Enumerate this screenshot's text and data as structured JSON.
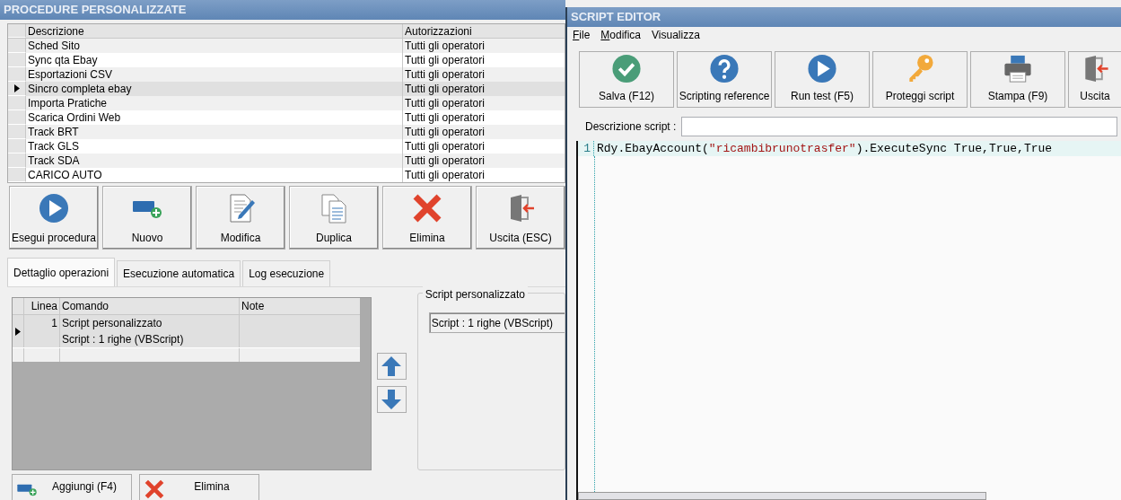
{
  "main_window": {
    "title": "PROCEDURE PERSONALIZZATE",
    "procedures_table": {
      "columns": [
        "Descrizione",
        "Autorizzazioni"
      ],
      "rows": [
        {
          "cells": [
            "Sched Sito",
            "Tutti gli operatori"
          ],
          "selected": false
        },
        {
          "cells": [
            "Sync qta Ebay",
            "Tutti gli operatori"
          ],
          "selected": false
        },
        {
          "cells": [
            "Esportazioni CSV",
            "Tutti gli operatori"
          ],
          "selected": false
        },
        {
          "cells": [
            "Sincro completa ebay",
            "Tutti gli operatori"
          ],
          "selected": true
        },
        {
          "cells": [
            "Importa Pratiche",
            "Tutti gli operatori"
          ],
          "selected": false
        },
        {
          "cells": [
            "Scarica Ordini Web",
            "Tutti gli operatori"
          ],
          "selected": false
        },
        {
          "cells": [
            "Track BRT",
            "Tutti gli operatori"
          ],
          "selected": false
        },
        {
          "cells": [
            "Track GLS",
            "Tutti gli operatori"
          ],
          "selected": false
        },
        {
          "cells": [
            "Track SDA",
            "Tutti gli operatori"
          ],
          "selected": false
        },
        {
          "cells": [
            "CARICO AUTO",
            "Tutti gli operatori"
          ],
          "selected": false
        }
      ]
    },
    "toolbar": [
      {
        "label": "Esegui procedura",
        "kind": "play"
      },
      {
        "label": "Nuovo",
        "kind": "add"
      },
      {
        "label": "Modifica",
        "kind": "edit"
      },
      {
        "label": "Duplica",
        "kind": "copy"
      },
      {
        "label": "Elimina",
        "kind": "delete"
      },
      {
        "label": "Uscita (ESC)",
        "kind": "exit"
      }
    ],
    "tabs": [
      {
        "label": "Dettaglio operazioni",
        "selected": true
      },
      {
        "label": "Esecuzione automatica",
        "selected": false
      },
      {
        "label": "Log esecuzione",
        "selected": false
      }
    ],
    "operations_table": {
      "columns": [
        "Linea",
        "Comando",
        "Note"
      ],
      "rows": [
        {
          "line": "1",
          "command": [
            "Script personalizzato",
            "Script : 1 righe (VBScript)"
          ],
          "selected": true
        }
      ]
    },
    "script_group": {
      "title": "Script personalizzato",
      "value": "Script : 1 righe (VBScript)"
    },
    "bottom_buttons": [
      {
        "label": "Aggiungi (F4)",
        "kind": "add"
      },
      {
        "label": "Elimina",
        "kind": "delete"
      }
    ]
  },
  "script_editor": {
    "title": "SCRIPT EDITOR",
    "menu": [
      {
        "label": "File",
        "mnemonic": true
      },
      {
        "label": "Modifica",
        "mnemonic": true
      },
      {
        "label": "Visualizza",
        "mnemonic": false
      }
    ],
    "toolbar": [
      {
        "label": "Salva (F12)",
        "kind": "save"
      },
      {
        "label": "Scripting reference",
        "kind": "help"
      },
      {
        "label": "Run test (F5)",
        "kind": "play"
      },
      {
        "label": "Proteggi script",
        "kind": "key"
      },
      {
        "label": "Stampa (F9)",
        "kind": "print"
      },
      {
        "label": "Uscita",
        "kind": "exit"
      }
    ],
    "description_label": "Descrizione script :",
    "code_lines": [
      {
        "number": "1",
        "parts": [
          {
            "text": "Rdy.EbayAccount(",
            "kind": "plain"
          },
          {
            "text": "\"ricambibrunotrasfer\"",
            "kind": "string"
          },
          {
            "text": ").ExecuteSync True,True,True",
            "kind": "plain"
          }
        ]
      }
    ]
  }
}
